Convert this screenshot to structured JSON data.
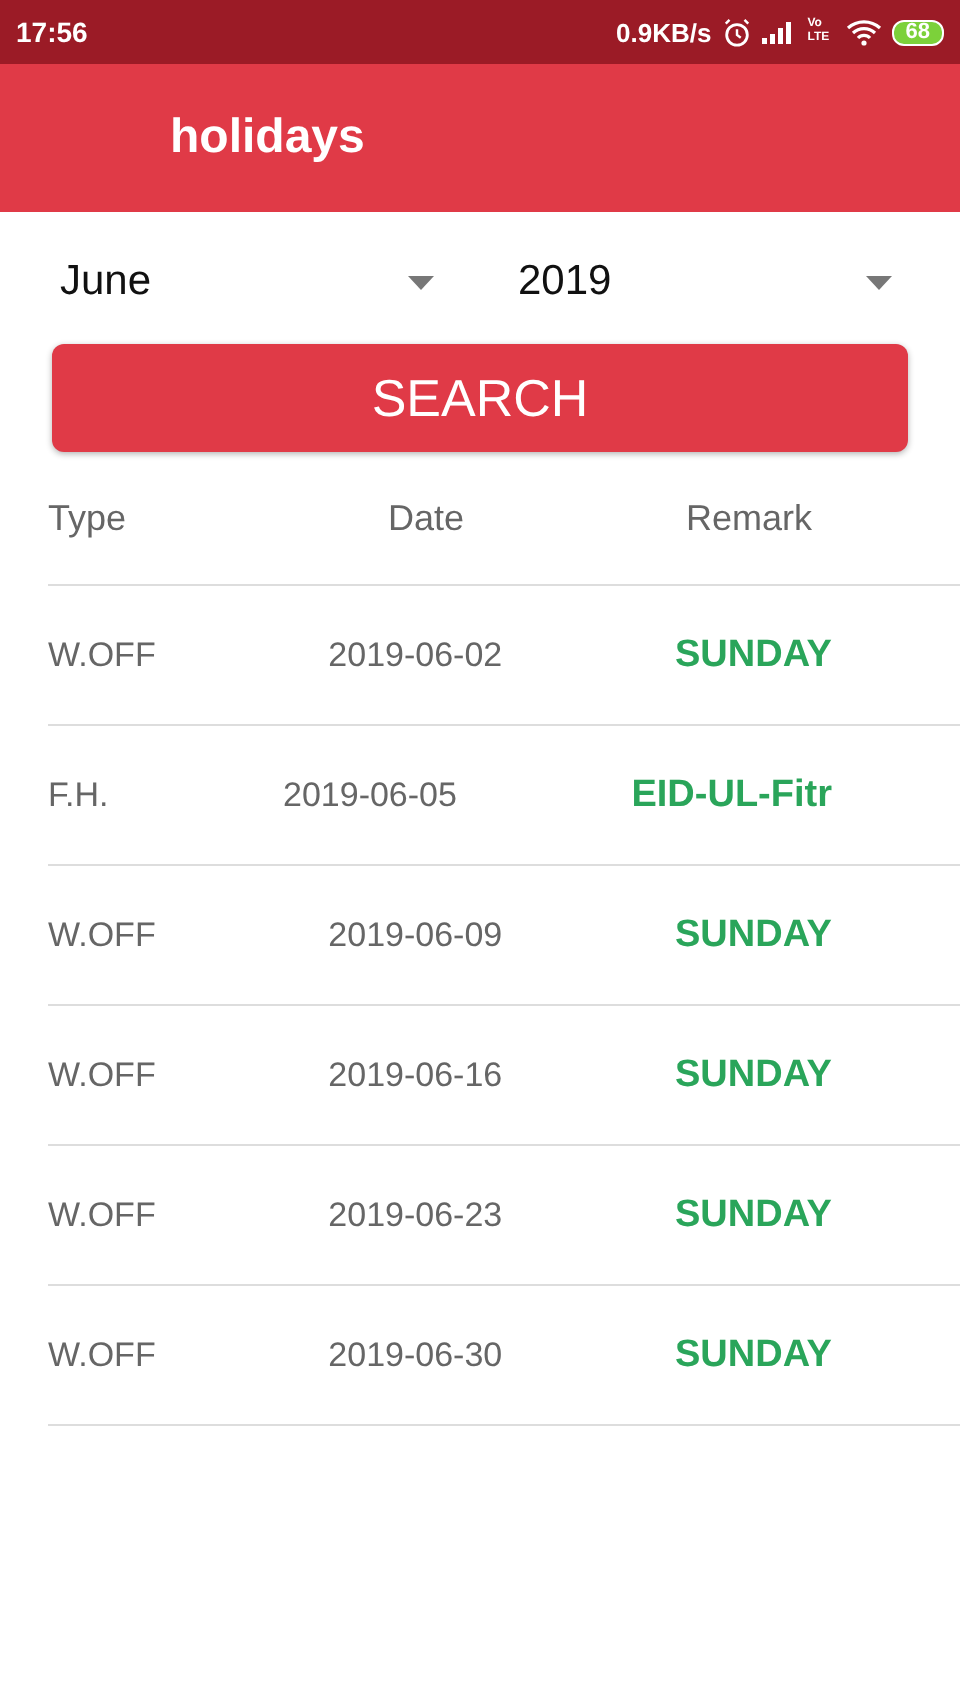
{
  "status_bar": {
    "time": "17:56",
    "speed": "0.9KB/s",
    "network": "Vo\nLTE",
    "battery": "68"
  },
  "app_bar": {
    "title": "holidays"
  },
  "filters": [
    {
      "value": "June"
    },
    {
      "value": "2019"
    }
  ],
  "search_button": "SEARCH",
  "table": {
    "columns": [
      "Type",
      "Date",
      "Remark"
    ],
    "rows": [
      {
        "type": "W.OFF",
        "date": "2019-06-02",
        "remark": "SUNDAY"
      },
      {
        "type": "F.H.",
        "date": "2019-06-05",
        "remark": "EID-UL-Fitr"
      },
      {
        "type": "W.OFF",
        "date": "2019-06-09",
        "remark": "SUNDAY"
      },
      {
        "type": "W.OFF",
        "date": "2019-06-16",
        "remark": "SUNDAY"
      },
      {
        "type": "W.OFF",
        "date": "2019-06-23",
        "remark": "SUNDAY"
      },
      {
        "type": "W.OFF",
        "date": "2019-06-30",
        "remark": "SUNDAY"
      }
    ]
  }
}
